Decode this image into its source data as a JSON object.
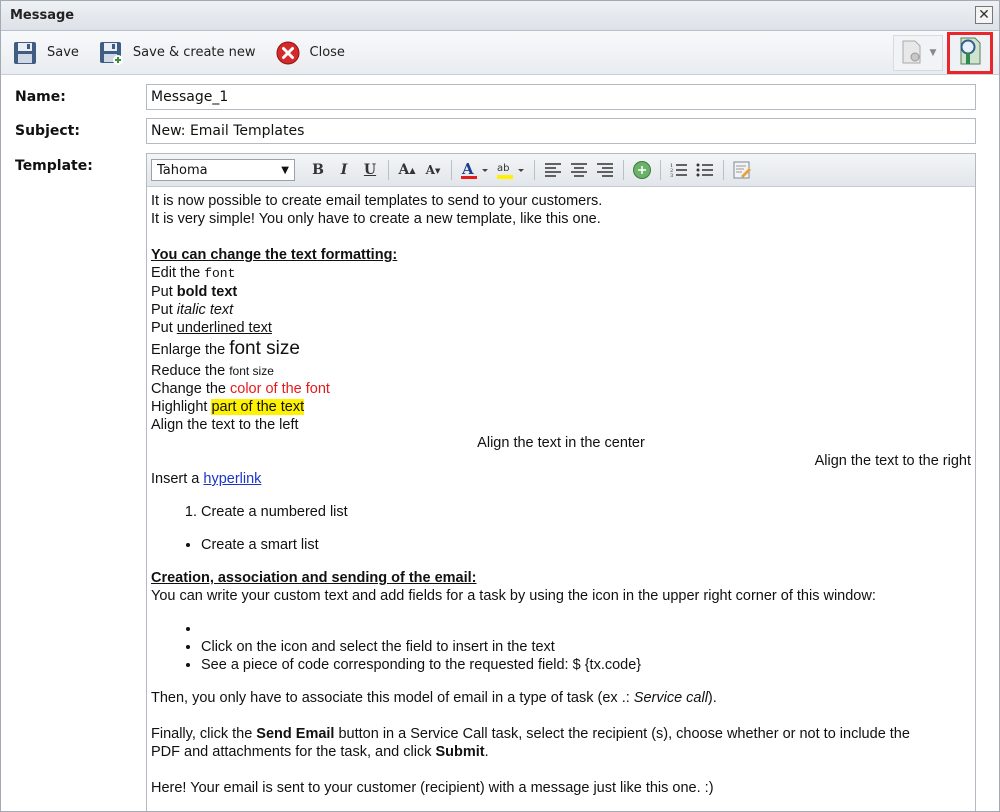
{
  "window": {
    "title": "Message",
    "close_glyph": "✕"
  },
  "toolbar": {
    "save_label": "Save",
    "save_create_label": "Save & create new",
    "close_label": "Close"
  },
  "form": {
    "name_label": "Name:",
    "name_value": "Message_1",
    "subject_label": "Subject:",
    "subject_value": "New: Email Templates",
    "template_label": "Template:"
  },
  "editor": {
    "font": "Tahoma",
    "body": {
      "intro1": "It is now possible to create email templates to send to your customers.",
      "intro2": "It is very simple! You only have to create a new template, like this one.",
      "heading1": "You can change the text formatting:",
      "font_pre": "Edit the ",
      "font_word": "font",
      "bold_pre": "Put ",
      "bold_word": "bold text",
      "italic_pre": "Put ",
      "italic_word": "italic text",
      "under_pre": "Put ",
      "under_word": "underlined text",
      "enlarge_pre": "Enlarge the ",
      "enlarge_word": "font size",
      "reduce_pre": "Reduce the ",
      "reduce_word": "font size",
      "color_pre": "Change the ",
      "color_word": "color of the font",
      "highlight_pre": "Highlight ",
      "highlight_word": "part of the text",
      "align_left": "Align the text to the left",
      "align_center": "Align the text in the center",
      "align_right": "Align the text to the right",
      "link_pre": "Insert a ",
      "link_word": "hyperlink",
      "numbered_item": "Create a numbered list",
      "smart_item": "Create a smart list",
      "heading2": "Creation, association and sending of the email:",
      "custom_text": "You can write your custom text and add fields for a task by using the icon in the upper right corner of this window:",
      "bullet1": "",
      "bullet2": "Click on the icon and select the field to insert in the text",
      "bullet3": "See a piece of code corresponding to the requested field: $ {tx.code}",
      "associate_pre": "Then, you only have to associate this model of email in a type of task (ex .: ",
      "associate_italic": "Service call",
      "associate_post": ").",
      "finally_pre": "Finally, click the ",
      "finally_bold": "Send Email",
      "finally_mid": " button in a Service Call task, select the recipient (s), choose whether or not to include the",
      "finally_line2_pre": "PDF and attachments for the task, and click ",
      "finally_bold2": "Submit",
      "finally_post": ".",
      "here": "Here! Your email is sent to your customer (recipient) with a message just like this one. :)"
    }
  },
  "colors": {
    "accent_red": "#e8262b",
    "text_red": "#e61c1c",
    "highlight": "#fff200",
    "link": "#1a35c8"
  },
  "icons": [
    "floppy-disk-icon",
    "floppy-disk-plus-icon",
    "close-circle-icon",
    "document-gear-icon",
    "field-inspector-icon"
  ]
}
